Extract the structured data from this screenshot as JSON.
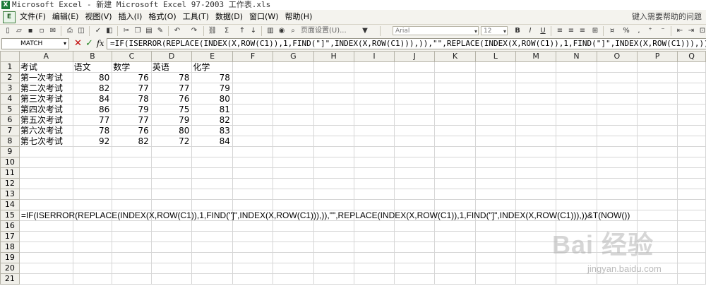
{
  "window": {
    "title": "Microsoft Excel - 新建 Microsoft Excel 97-2003 工作表.xls",
    "app_icon": "X"
  },
  "menubar": {
    "doc_icon": "E",
    "items": [
      "文件(F)",
      "编辑(E)",
      "视图(V)",
      "插入(I)",
      "格式(O)",
      "工具(T)",
      "数据(D)",
      "窗口(W)",
      "帮助(H)"
    ],
    "help_search": "键入需要帮助的问题"
  },
  "toolbar": {
    "page_setup_label": "页面设置(U)...",
    "font_name": "Arial",
    "font_size": "12",
    "bold": "B",
    "italic": "I",
    "underline": "U",
    "percent": "%",
    "comma": ","
  },
  "formula_bar": {
    "name_box": "MATCH",
    "cancel": "✕",
    "enter": "✓",
    "fx": "fx",
    "formula": "=IF(ISERROR(REPLACE(INDEX(X,ROW(C1)),1,FIND(\"]\",INDEX(X,ROW(C1))),)),\"\",REPLACE(INDEX(X,ROW(C1)),1,FIND(\"]\",INDEX(X,ROW(C1))),))&T(N"
  },
  "sheet": {
    "columns": [
      "A",
      "B",
      "C",
      "D",
      "E",
      "F",
      "G",
      "H",
      "I",
      "J",
      "K",
      "L",
      "M",
      "N",
      "O",
      "P",
      "Q"
    ],
    "row_numbers": [
      "1",
      "2",
      "3",
      "4",
      "5",
      "6",
      "7",
      "8",
      "9",
      "10",
      "11",
      "12",
      "13",
      "14",
      "15",
      "16",
      "17",
      "18",
      "19",
      "20",
      "21"
    ],
    "header_row": [
      "考试",
      "语文",
      "数学",
      "英语",
      "化学"
    ],
    "rows": [
      [
        "第一次考试",
        "80",
        "76",
        "78",
        "78"
      ],
      [
        "第二次考试",
        "82",
        "77",
        "77",
        "79"
      ],
      [
        "第三次考试",
        "84",
        "78",
        "76",
        "80"
      ],
      [
        "第四次考试",
        "86",
        "79",
        "75",
        "81"
      ],
      [
        "第五次考试",
        "77",
        "77",
        "79",
        "82"
      ],
      [
        "第六次考试",
        "78",
        "76",
        "80",
        "83"
      ],
      [
        "第七次考试",
        "92",
        "82",
        "72",
        "84"
      ]
    ],
    "a15_formula": "=IF(ISERROR(REPLACE(INDEX(X,ROW(C1)),1,FIND(\"]\",INDEX(X,ROW(C1))),)),\"\",REPLACE(INDEX(X,ROW(C1)),1,FIND(\"]\",INDEX(X,ROW(C1))),))&T(NOW())"
  },
  "watermark": {
    "text": "Bai 经验",
    "url": "jingyan.baidu.com"
  }
}
